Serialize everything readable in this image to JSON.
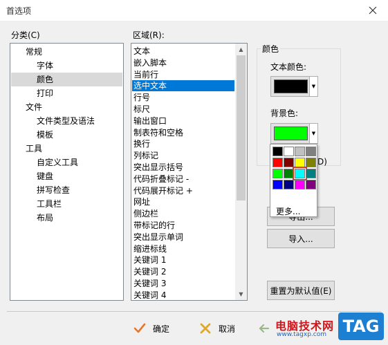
{
  "window": {
    "title": "首选项"
  },
  "category": {
    "label": "分类(C)",
    "items": [
      {
        "label": "常规",
        "level": 0
      },
      {
        "label": "字体",
        "level": 1
      },
      {
        "label": "颜色",
        "level": 1,
        "selected": true
      },
      {
        "label": "打印",
        "level": 1
      },
      {
        "label": "文件",
        "level": 0
      },
      {
        "label": "文件类型及语法",
        "level": 1
      },
      {
        "label": "模板",
        "level": 1
      },
      {
        "label": "工具",
        "level": 0
      },
      {
        "label": "自定义工具",
        "level": 1
      },
      {
        "label": "键盘",
        "level": 1
      },
      {
        "label": "拼写检查",
        "level": 1
      },
      {
        "label": "工具栏",
        "level": 1
      },
      {
        "label": "布局",
        "level": 1
      }
    ]
  },
  "region": {
    "label": "区域(R):",
    "items": [
      "文本",
      "嵌入脚本",
      "当前行",
      "选中文本",
      "行号",
      "标尺",
      "输出窗口",
      "制表符和空格",
      "换行",
      "列标记",
      "突出显示括号",
      "代码折叠标记 -",
      "代码展开标记 +",
      "网址",
      "侧边栏",
      "带标记的行",
      "突出显示单词",
      "缩进标线",
      "关键词 1",
      "关键词 2",
      "关键词 3",
      "关键词 4"
    ],
    "selected_index": 3
  },
  "color_group": {
    "title": "颜色",
    "text_color_label": "文本颜色:",
    "text_color": "#000000",
    "bg_color_label": "背景色:",
    "bg_color": "#00ff00",
    "partial_label_suffix": "D)"
  },
  "palette": {
    "colors": [
      "#000000",
      "#ffffff",
      "#c0c0c0",
      "#808080",
      "#ff0000",
      "#800000",
      "#ffff00",
      "#808000",
      "#00ff00",
      "#008000",
      "#00ffff",
      "#008080",
      "#0000ff",
      "#000080",
      "#ff00ff",
      "#800080"
    ],
    "highlighted_index": 10,
    "more_label": "更多..."
  },
  "buttons": {
    "export_partial": "导出...",
    "import": "导入...",
    "reset": "重置为默认值(E)"
  },
  "footer": {
    "ok": "确定",
    "cancel": "取消"
  },
  "watermark": {
    "site": "电脑技术网",
    "url": "www.tagxp.com",
    "badge": "TAG"
  }
}
